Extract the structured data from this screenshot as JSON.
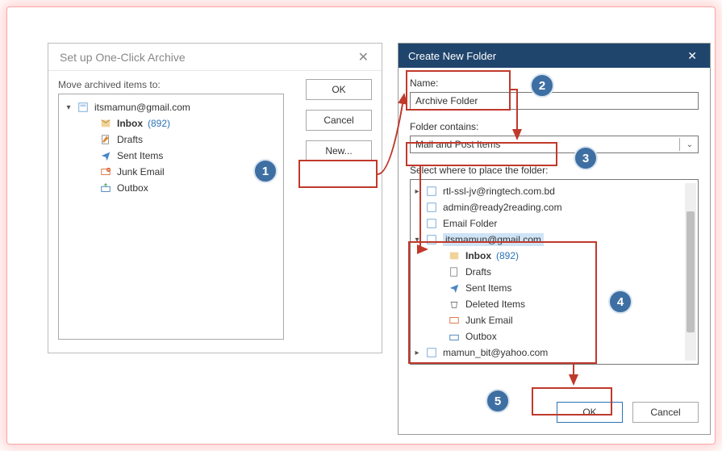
{
  "colors": {
    "accent": "#2b73b7",
    "titlebar": "#20456d",
    "badge": "#3e6fa3",
    "annotation": "#c0392b"
  },
  "dlg1": {
    "title": "Set up One-Click Archive",
    "move_label": "Move archived items to:",
    "buttons": {
      "ok": "OK",
      "cancel": "Cancel",
      "new": "New..."
    },
    "tree": {
      "root": "itsmamun@gmail.com",
      "items": [
        {
          "name": "Inbox",
          "count": "(892)",
          "icon": "inbox",
          "bold": true
        },
        {
          "name": "Drafts",
          "icon": "drafts"
        },
        {
          "name": "Sent Items",
          "icon": "sent"
        },
        {
          "name": "Junk Email",
          "icon": "junk"
        },
        {
          "name": "Outbox",
          "icon": "outbox"
        }
      ]
    }
  },
  "dlg2": {
    "title": "Create New Folder",
    "name_label": "Name:",
    "name_value": "Archive Folder",
    "contains_label": "Folder contains:",
    "contains_value": "Mail and Post Items",
    "place_label": "Select where to place the folder:",
    "buttons": {
      "ok": "OK",
      "cancel": "Cancel"
    },
    "tree": {
      "roots": [
        {
          "name": "rtl-ssl-jv@ringtech.com.bd",
          "expandable": true
        },
        {
          "name": "admin@ready2reading.com"
        },
        {
          "name": "Email Folder"
        }
      ],
      "expanded": {
        "name": "itsmamun@gmail.com",
        "items": [
          {
            "name": "Inbox",
            "count": "(892)",
            "icon": "inbox",
            "bold": true
          },
          {
            "name": "Drafts",
            "icon": "drafts"
          },
          {
            "name": "Sent Items",
            "icon": "sent"
          },
          {
            "name": "Deleted Items",
            "icon": "deleted"
          },
          {
            "name": "Junk Email",
            "icon": "junk"
          },
          {
            "name": "Outbox",
            "icon": "outbox"
          }
        ]
      },
      "last": {
        "name": "mamun_bit@yahoo.com",
        "expandable": true
      }
    }
  },
  "badges": [
    "1",
    "2",
    "3",
    "4",
    "5"
  ]
}
